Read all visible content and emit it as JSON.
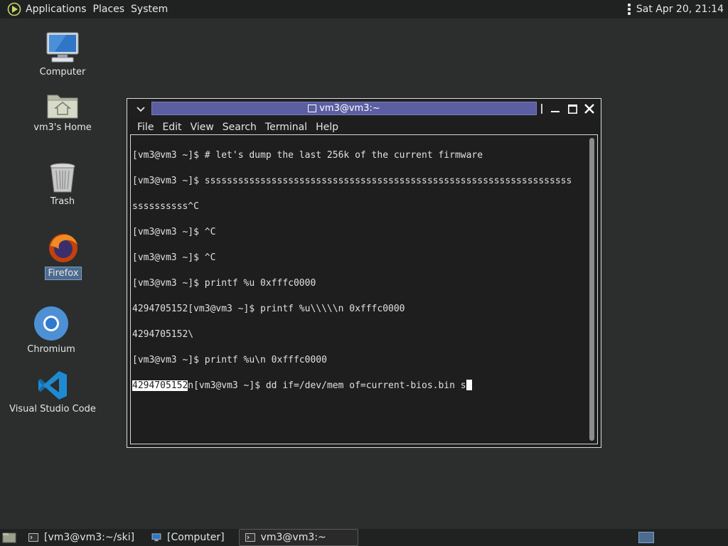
{
  "top_panel": {
    "applications": "Applications",
    "places": "Places",
    "system": "System",
    "clock": "Sat Apr 20, 21:14"
  },
  "desktop_icons": [
    {
      "label": "Computer",
      "icon": "computer-icon"
    },
    {
      "label": "vm3's Home",
      "icon": "home-folder-icon"
    },
    {
      "label": "Trash",
      "icon": "trash-icon"
    },
    {
      "label": "Firefox",
      "icon": "firefox-icon",
      "selected": true
    },
    {
      "label": "Chromium",
      "icon": "chromium-icon"
    },
    {
      "label": "Visual Studio Code",
      "icon": "vscode-icon"
    }
  ],
  "terminal": {
    "title": "vm3@vm3:~",
    "menu": [
      "File",
      "Edit",
      "View",
      "Search",
      "Terminal",
      "Help"
    ],
    "lines": [
      "[vm3@vm3 ~]$ # let's dump the last 256k of the current firmware",
      "[vm3@vm3 ~]$ ssssssssssssssssssssssssssssssssssssssssssssssssssssssssssssssssss",
      "ssssssssss^C",
      "[vm3@vm3 ~]$ ^C",
      "[vm3@vm3 ~]$ ^C",
      "[vm3@vm3 ~]$ printf %u 0xfffc0000",
      "4294705152[vm3@vm3 ~]$ printf %u\\\\\\\\\\n 0xfffc0000",
      "4294705152\\",
      "[vm3@vm3 ~]$ printf %u\\n 0xfffc0000"
    ],
    "last_line_highlight": "4294705152",
    "last_line_rest": "n[vm3@vm3 ~]$ dd if=/dev/mem of=current-bios.bin s"
  },
  "taskbar": {
    "tasks": [
      "[vm3@vm3:~/ski]",
      "[Computer]",
      "vm3@vm3:~"
    ]
  },
  "colors": {
    "desktop_bg": "#2b2e2d",
    "panel_bg": "#1f2221",
    "title_active": "#5b5ea0",
    "selection": "#4b6b8f"
  }
}
